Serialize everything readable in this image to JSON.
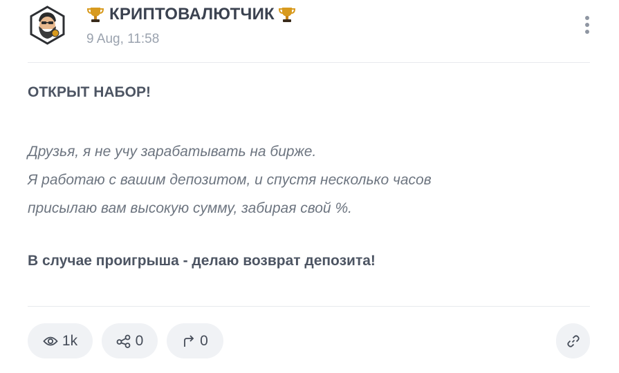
{
  "post": {
    "author": {
      "name": "КРИПТОВАЛЮТЧИК",
      "avatar_icon": "bearded-man-avatar-icon",
      "badge_icon": "trophy-icon",
      "badge_color": "#d89a1e"
    },
    "timestamp": "9 Aug, 11:58",
    "menu_icon": "more-vertical-icon",
    "heading": "ОТКРЫТ НАБОР!",
    "italic_lines": [
      "Друзья, я не учу зарабатывать на бирже.",
      "Я работаю с вашим депозитом, и спустя несколько часов",
      "присылаю вам высокую сумму, забирая свой %."
    ],
    "closing": "В случае проигрыша - делаю возврат депозита!"
  },
  "actions": {
    "views": {
      "icon": "eye-icon",
      "count": "1k"
    },
    "shares": {
      "icon": "share-icon",
      "count": "0"
    },
    "forwards": {
      "icon": "forward-arrow-icon",
      "count": "0"
    },
    "link": {
      "icon": "link-icon"
    }
  },
  "colors": {
    "text_primary": "#4d5563",
    "text_secondary": "#9aa2ae",
    "pill_background": "#f0f2f5",
    "divider": "#e7e9ed"
  }
}
